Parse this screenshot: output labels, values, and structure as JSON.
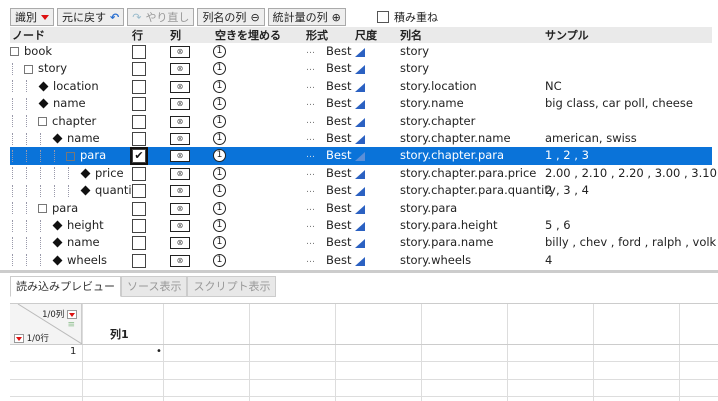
{
  "toolbar": {
    "identify": "識別",
    "undo": "元に戻す",
    "redo": "やり直し",
    "colname_col": "列名の列",
    "stats_col": "統計量の列",
    "stack": "積み重ね"
  },
  "headers": {
    "node": "ノード",
    "row": "行",
    "col": "列",
    "fill": "空きを埋める",
    "format": "形式",
    "scale": "尺度",
    "colname": "列名",
    "sample": "サンプル"
  },
  "rows": [
    {
      "label": "book",
      "type": "group",
      "depth": 0,
      "colname": "story",
      "sample": ""
    },
    {
      "label": "story",
      "type": "group",
      "depth": 1,
      "colname": "story",
      "sample": ""
    },
    {
      "label": "location",
      "type": "leaf",
      "depth": 2,
      "colname": "story.location",
      "sample": "NC"
    },
    {
      "label": "name",
      "type": "leaf",
      "depth": 2,
      "colname": "story.name",
      "sample": "big class, car poll, cheese"
    },
    {
      "label": "chapter",
      "type": "group",
      "depth": 2,
      "colname": "story.chapter",
      "sample": ""
    },
    {
      "label": "name",
      "type": "leaf",
      "depth": 3,
      "colname": "story.chapter.name",
      "sample": "american, swiss"
    },
    {
      "label": "para",
      "type": "group",
      "depth": 4,
      "colname": "story.chapter.para",
      "sample": "1 , 2 , 3",
      "selected": true
    },
    {
      "label": "price",
      "type": "leaf",
      "depth": 5,
      "colname": "story.chapter.para.price",
      "sample": "2.00 , 2.10 , 2.20 , 3.00 , 3.10"
    },
    {
      "label": "quantity",
      "type": "leaf",
      "depth": 5,
      "colname": "story.chapter.para.quantity",
      "sample": "2 , 3 , 4"
    },
    {
      "label": "para",
      "type": "group",
      "depth": 2,
      "colname": "story.para",
      "sample": ""
    },
    {
      "label": "height",
      "type": "leaf",
      "depth": 3,
      "colname": "story.para.height",
      "sample": "5 , 6"
    },
    {
      "label": "name",
      "type": "leaf",
      "depth": 3,
      "colname": "story.para.name",
      "sample": "billy , chev , ford , ralph , volk"
    },
    {
      "label": "wheels",
      "type": "leaf",
      "depth": 3,
      "colname": "story.wheels",
      "sample": "4"
    }
  ],
  "format_value": "Best",
  "fill_glyph": "1",
  "tabs": [
    "読み込みプレビュー",
    "ソース表示",
    "スクリプト表示"
  ],
  "preview": {
    "cols_count": "1/0列",
    "rows_count": "1/0行",
    "col1": "列1",
    "row1": "1",
    "cell": "•"
  }
}
